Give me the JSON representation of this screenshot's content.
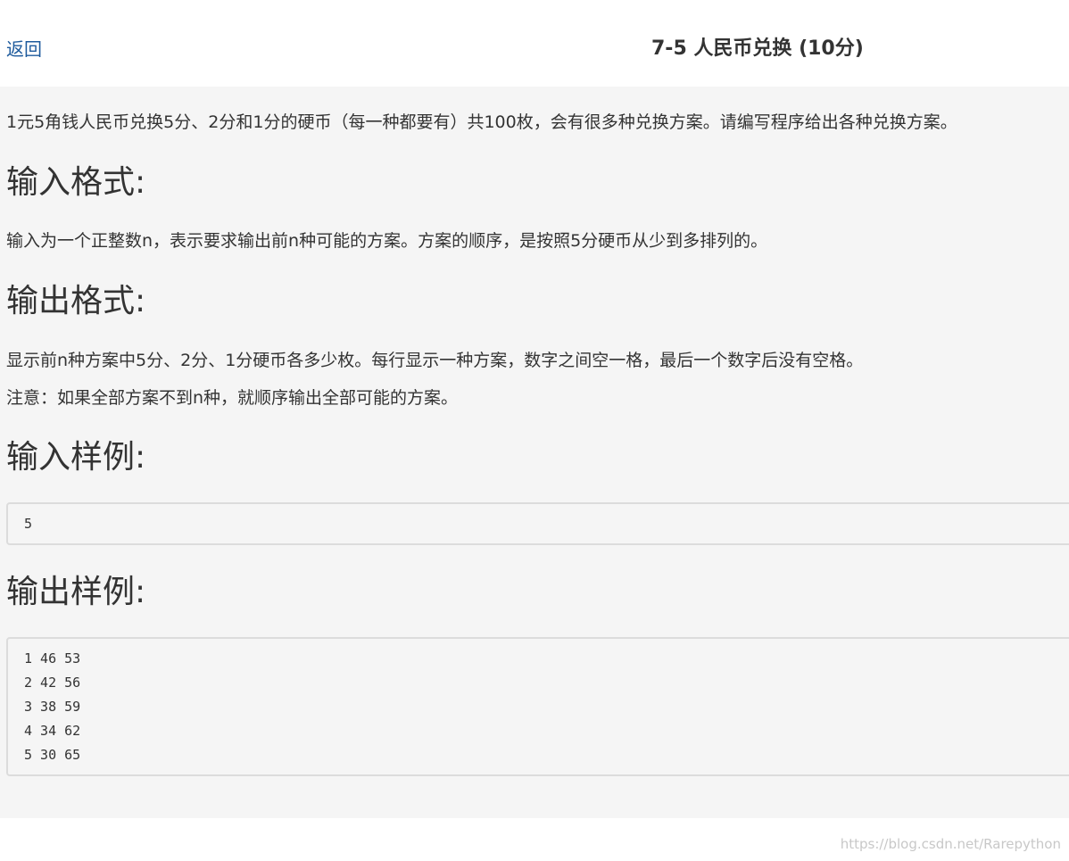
{
  "header": {
    "back_label": "返回",
    "title": "7-5 人民币兑换 (10分)"
  },
  "problem": {
    "description": "1元5角钱人民币兑换5分、2分和1分的硬币（每一种都要有）共100枚，会有很多种兑换方案。请编写程序给出各种兑换方案。",
    "input_heading": "输入格式:",
    "input_text": "输入为一个正整数n，表示要求输出前n种可能的方案。方案的顺序，是按照5分硬币从少到多排列的。",
    "output_heading": "输出格式:",
    "output_text": "显示前n种方案中5分、2分、1分硬币各多少枚。每行显示一种方案，数字之间空一格，最后一个数字后没有空格。",
    "output_note": "注意：如果全部方案不到n种，就顺序输出全部可能的方案。",
    "sample_input_heading": "输入样例:",
    "sample_input": [
      "5"
    ],
    "sample_output_heading": "输出样例:",
    "sample_output": [
      "1 46 53",
      "2 42 56",
      "3 38 59",
      "4 34 62",
      "5 30 65"
    ]
  },
  "watermark": "https://blog.csdn.net/Rarepython",
  "colors": {
    "link": "#1d5a9c",
    "content_bg": "#f5f5f5",
    "text": "#333333"
  }
}
